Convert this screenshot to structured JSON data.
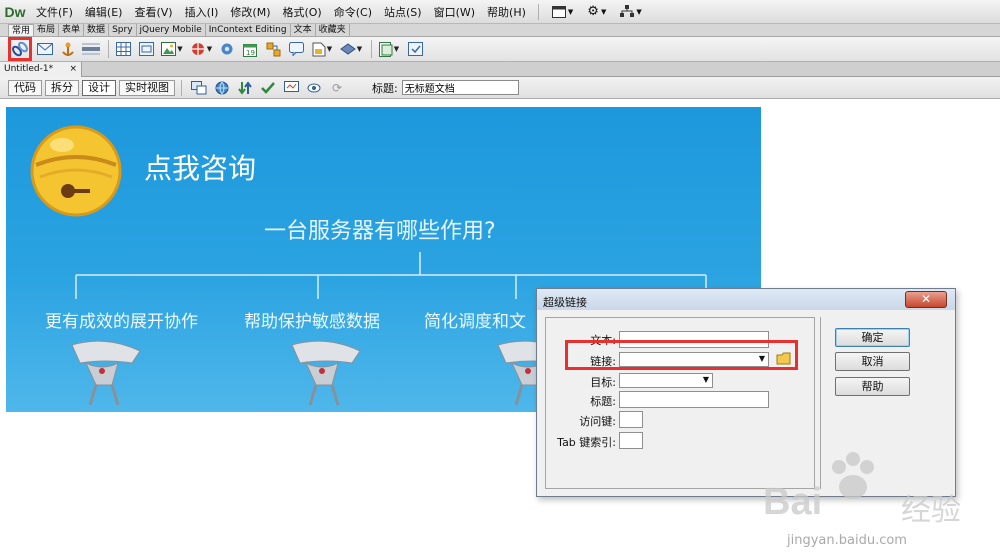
{
  "app": {
    "logo": "Dw"
  },
  "menubar": {
    "items": [
      "文件(F)",
      "编辑(E)",
      "查看(V)",
      "插入(I)",
      "修改(M)",
      "格式(O)",
      "命令(C)",
      "站点(S)",
      "窗口(W)",
      "帮助(H)"
    ],
    "tools": [
      "layout-icon",
      "gear-icon",
      "site-icon"
    ]
  },
  "insert_tabs": {
    "items": [
      "常用",
      "布局",
      "表单",
      "数据",
      "Spry",
      "jQuery Mobile",
      "InContext Editing",
      "文本",
      "收藏夹"
    ],
    "active_index": 0
  },
  "insert_toolbar": {
    "icons": [
      "hyperlink-icon",
      "email-link-icon",
      "named-anchor-icon",
      "horizontal-rule-icon",
      "table-icon",
      "insert-div-icon",
      "image-icon",
      "media-icon",
      "widget-icon",
      "date-icon",
      "server-include-icon",
      "comment-icon",
      "head-icon",
      "script-icon",
      "templates-icon",
      "tag-chooser-icon"
    ],
    "highlighted": "hyperlink-icon"
  },
  "document": {
    "tab_label": "Untitled-1*",
    "close_glyph": "×"
  },
  "doc_toolbar": {
    "views": [
      "代码",
      "拆分",
      "设计",
      "实时视图"
    ],
    "active_view": "设计",
    "title_label": "标题:",
    "title_value": "无标题文档"
  },
  "canvas": {
    "banner_title": "点我咨询",
    "question": "一台服务器有哪些作用?",
    "topics": [
      "更有成效的展开协作",
      "帮助保护敏感数据",
      "简化调度和文"
    ]
  },
  "dialog": {
    "title": "超级链接",
    "close_glyph": "✕",
    "fields": {
      "text_label": "文本:",
      "link_label": "链接:",
      "target_label": "目标:",
      "title_label": "标题:",
      "access_key_label": "访问键:",
      "tab_index_label": "Tab 键索引:"
    },
    "buttons": {
      "ok": "确定",
      "cancel": "取消",
      "help": "帮助"
    }
  },
  "watermark": {
    "brand": "Bai",
    "brand_cn": "经验",
    "url": "jingyan.baidu.com"
  },
  "colors": {
    "banner_blue": "#1d98dc",
    "highlight_red": "#e8302f",
    "bell_yellow": "#f4c531"
  }
}
